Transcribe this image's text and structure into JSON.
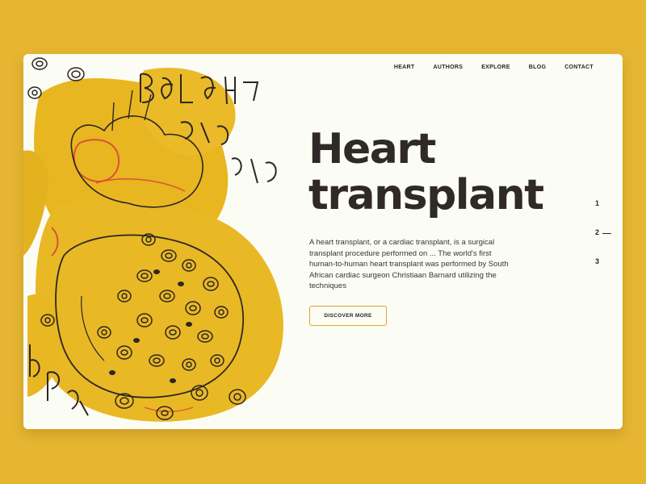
{
  "nav": {
    "items": [
      "HEART",
      "AUTHORS",
      "EXPLORE",
      "BLOG",
      "CONTACT"
    ]
  },
  "hero": {
    "title_line1": "Heart",
    "title_line2": "transplant",
    "description": "A heart transplant, or a cardiac transplant, is a surgical transplant procedure performed on ... The world's first human-to-human heart transplant was performed by South African cardiac surgeon Christiaan Barnard utilizing the techniques",
    "cta_label": "DISCOVER MORE"
  },
  "pagination": {
    "pages": [
      "1",
      "2",
      "3"
    ],
    "active": "2"
  },
  "colors": {
    "background": "#e6b632",
    "card": "#fbfcf4",
    "accent": "#e0a92a",
    "text": "#2f2a27"
  }
}
